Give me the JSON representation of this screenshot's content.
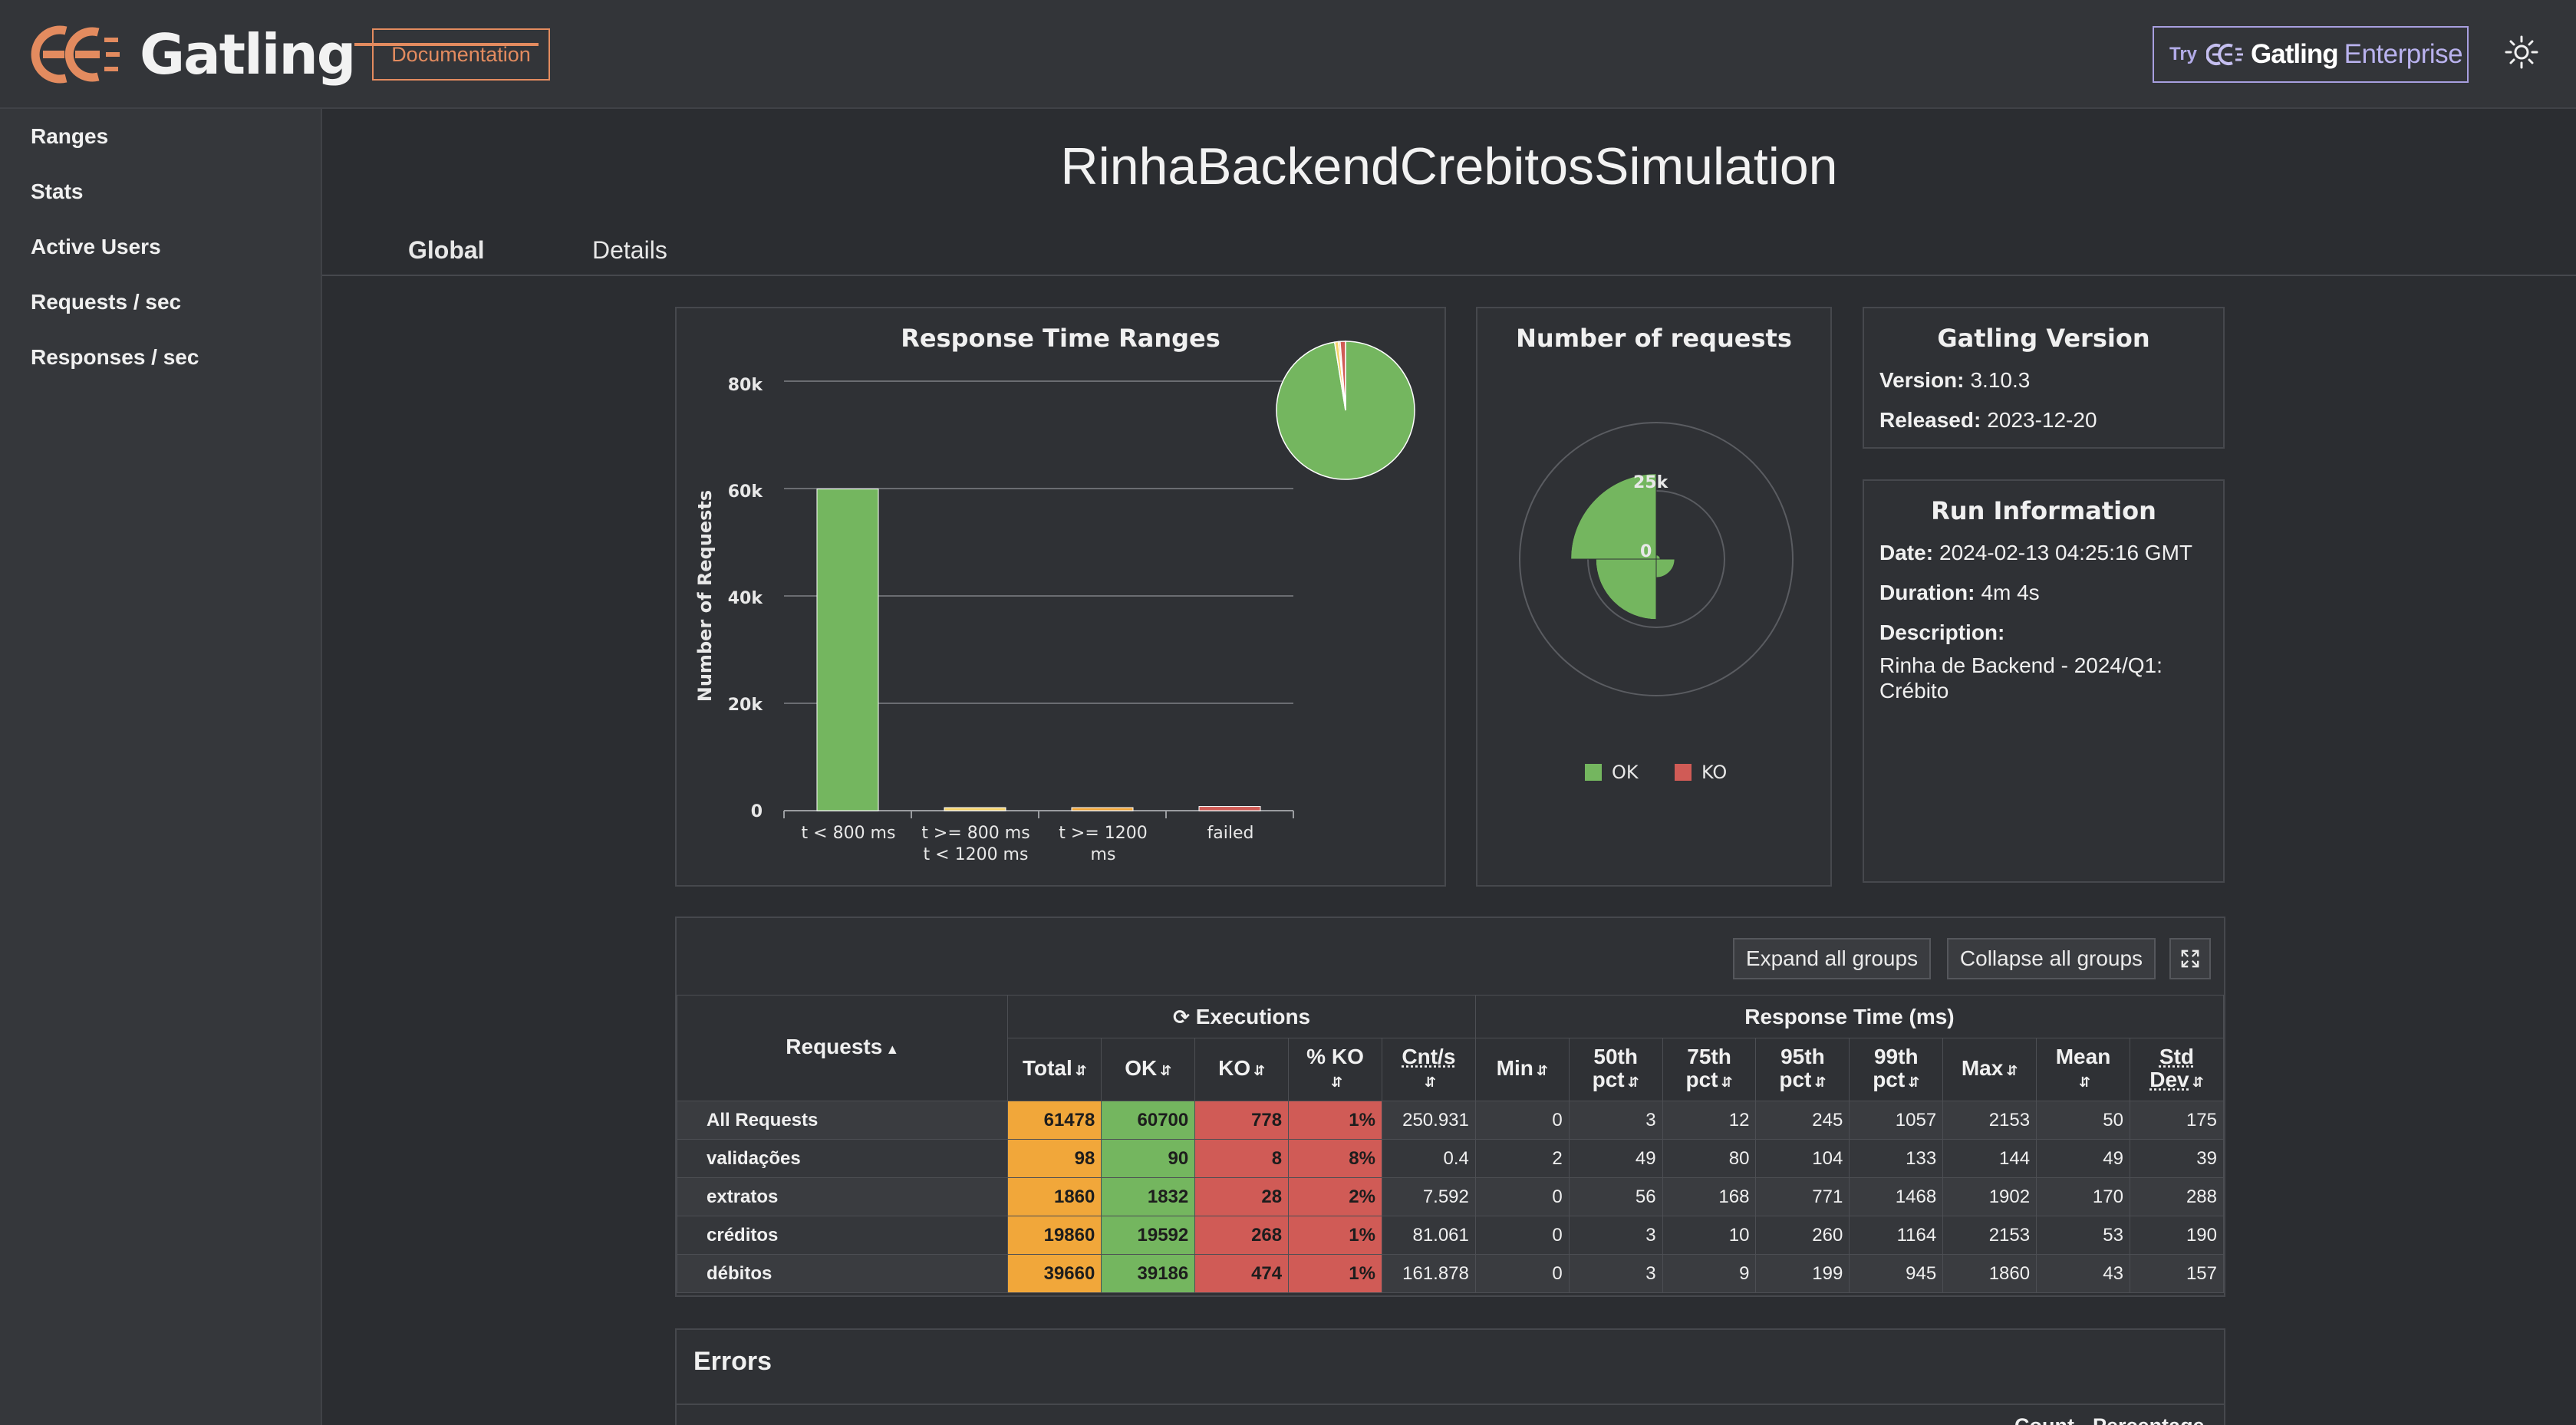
{
  "header": {
    "logo_text": "Gatling",
    "documentation_label": "Documentation",
    "try_label": "Try",
    "enterprise_brand": "Gatling",
    "enterprise_suffix": "Enterprise"
  },
  "sidebar": {
    "items": [
      {
        "label": "Ranges"
      },
      {
        "label": "Stats"
      },
      {
        "label": "Active Users"
      },
      {
        "label": "Requests / sec"
      },
      {
        "label": "Responses / sec"
      }
    ]
  },
  "simulation_title": "RinhaBackendCrebitosSimulation",
  "tabs": [
    {
      "label": "Global",
      "active": true
    },
    {
      "label": "Details",
      "active": false
    }
  ],
  "response_time_ranges": {
    "title": "Response Time Ranges",
    "ylabel": "Number of Requests",
    "yticks": [
      "0",
      "20k",
      "40k",
      "60k",
      "80k"
    ],
    "categories": [
      {
        "line1": "t < 800 ms",
        "line2": ""
      },
      {
        "line1": "t >= 800 ms",
        "line2": "t < 1200 ms"
      },
      {
        "line1": "t >= 1200",
        "line2": "ms"
      },
      {
        "line1": "failed",
        "line2": ""
      }
    ]
  },
  "number_of_requests": {
    "title": "Number of requests",
    "ring_labels": [
      "25k",
      "0"
    ],
    "legend": [
      {
        "label": "OK",
        "color": "#74b65f"
      },
      {
        "label": "KO",
        "color": "#d05b56"
      }
    ]
  },
  "chart_data": [
    {
      "type": "bar",
      "title": "Response Time Ranges",
      "ylabel": "Number of Requests",
      "ylim": [
        0,
        80000
      ],
      "categories": [
        "t < 800 ms",
        "t >= 800 ms t < 1200 ms",
        "t >= 1200 ms",
        "failed"
      ],
      "values": [
        59920,
        550,
        230,
        778
      ],
      "colors": [
        "#74b65f",
        "#f5d36b",
        "#f1a73a",
        "#d05b56"
      ],
      "inset_pie": {
        "values": [
          59920,
          550,
          230,
          778
        ],
        "colors": [
          "#74b65f",
          "#f5d36b",
          "#f1a73a",
          "#d05b56"
        ]
      }
    },
    {
      "type": "pie",
      "title": "Number of requests",
      "chart_form": "polar-area",
      "categories": [
        "validações",
        "extratos",
        "créditos",
        "débitos"
      ],
      "series": [
        {
          "name": "OK",
          "values": [
            90,
            1832,
            19592,
            39186
          ],
          "color": "#74b65f"
        },
        {
          "name": "KO",
          "values": [
            8,
            28,
            268,
            474
          ],
          "color": "#d05b56"
        }
      ]
    }
  ],
  "gatling_version": {
    "title": "Gatling Version",
    "version_label": "Version:",
    "version_value": "3.10.3",
    "released_label": "Released:",
    "released_value": "2023-12-20"
  },
  "run_information": {
    "title": "Run Information",
    "date_label": "Date:",
    "date_value": "2024-02-13 04:25:16 GMT",
    "duration_label": "Duration:",
    "duration_value": "4m 4s",
    "description_label": "Description:",
    "description_line1": "Rinha de Backend - 2024/Q1:",
    "description_line2": "Crébito"
  },
  "stats_table": {
    "expand_label": "Expand all groups",
    "collapse_label": "Collapse all groups",
    "requests_header": "Requests",
    "executions_header": "Executions",
    "response_time_header": "Response Time (ms)",
    "columns": {
      "total": "Total",
      "ok": "OK",
      "ko": "KO",
      "pct_ko": "% KO",
      "cnt_s": "Cnt/s",
      "min": "Min",
      "p50_1": "50th",
      "p50_2": "pct",
      "p75_1": "75th",
      "p75_2": "pct",
      "p95_1": "95th",
      "p95_2": "pct",
      "p99_1": "99th",
      "p99_2": "pct",
      "max": "Max",
      "mean": "Mean",
      "std_1": "Std",
      "std_2": "Dev"
    },
    "rows": [
      {
        "name": "All Requests",
        "total": "61478",
        "ok": "60700",
        "ko": "778",
        "pct_ko": "1%",
        "cnt": "250.931",
        "min": "0",
        "p50": "3",
        "p75": "12",
        "p95": "245",
        "p99": "1057",
        "max": "2153",
        "mean": "50",
        "std": "175"
      },
      {
        "name": "validações",
        "total": "98",
        "ok": "90",
        "ko": "8",
        "pct_ko": "8%",
        "cnt": "0.4",
        "min": "2",
        "p50": "49",
        "p75": "80",
        "p95": "104",
        "p99": "133",
        "max": "144",
        "mean": "49",
        "std": "39"
      },
      {
        "name": "extratos",
        "total": "1860",
        "ok": "1832",
        "ko": "28",
        "pct_ko": "2%",
        "cnt": "7.592",
        "min": "0",
        "p50": "56",
        "p75": "168",
        "p95": "771",
        "p99": "1468",
        "max": "1902",
        "mean": "170",
        "std": "288"
      },
      {
        "name": "créditos",
        "total": "19860",
        "ok": "19592",
        "ko": "268",
        "pct_ko": "1%",
        "cnt": "81.061",
        "min": "0",
        "p50": "3",
        "p75": "10",
        "p95": "260",
        "p99": "1164",
        "max": "2153",
        "mean": "53",
        "std": "190"
      },
      {
        "name": "débitos",
        "total": "39660",
        "ok": "39186",
        "ko": "474",
        "pct_ko": "1%",
        "cnt": "161.878",
        "min": "0",
        "p50": "3",
        "p75": "9",
        "p95": "199",
        "p99": "945",
        "max": "1860",
        "mean": "43",
        "std": "157"
      }
    ]
  },
  "errors": {
    "title": "Errors",
    "count_header": "Count",
    "percentage_header": "Percentage"
  }
}
